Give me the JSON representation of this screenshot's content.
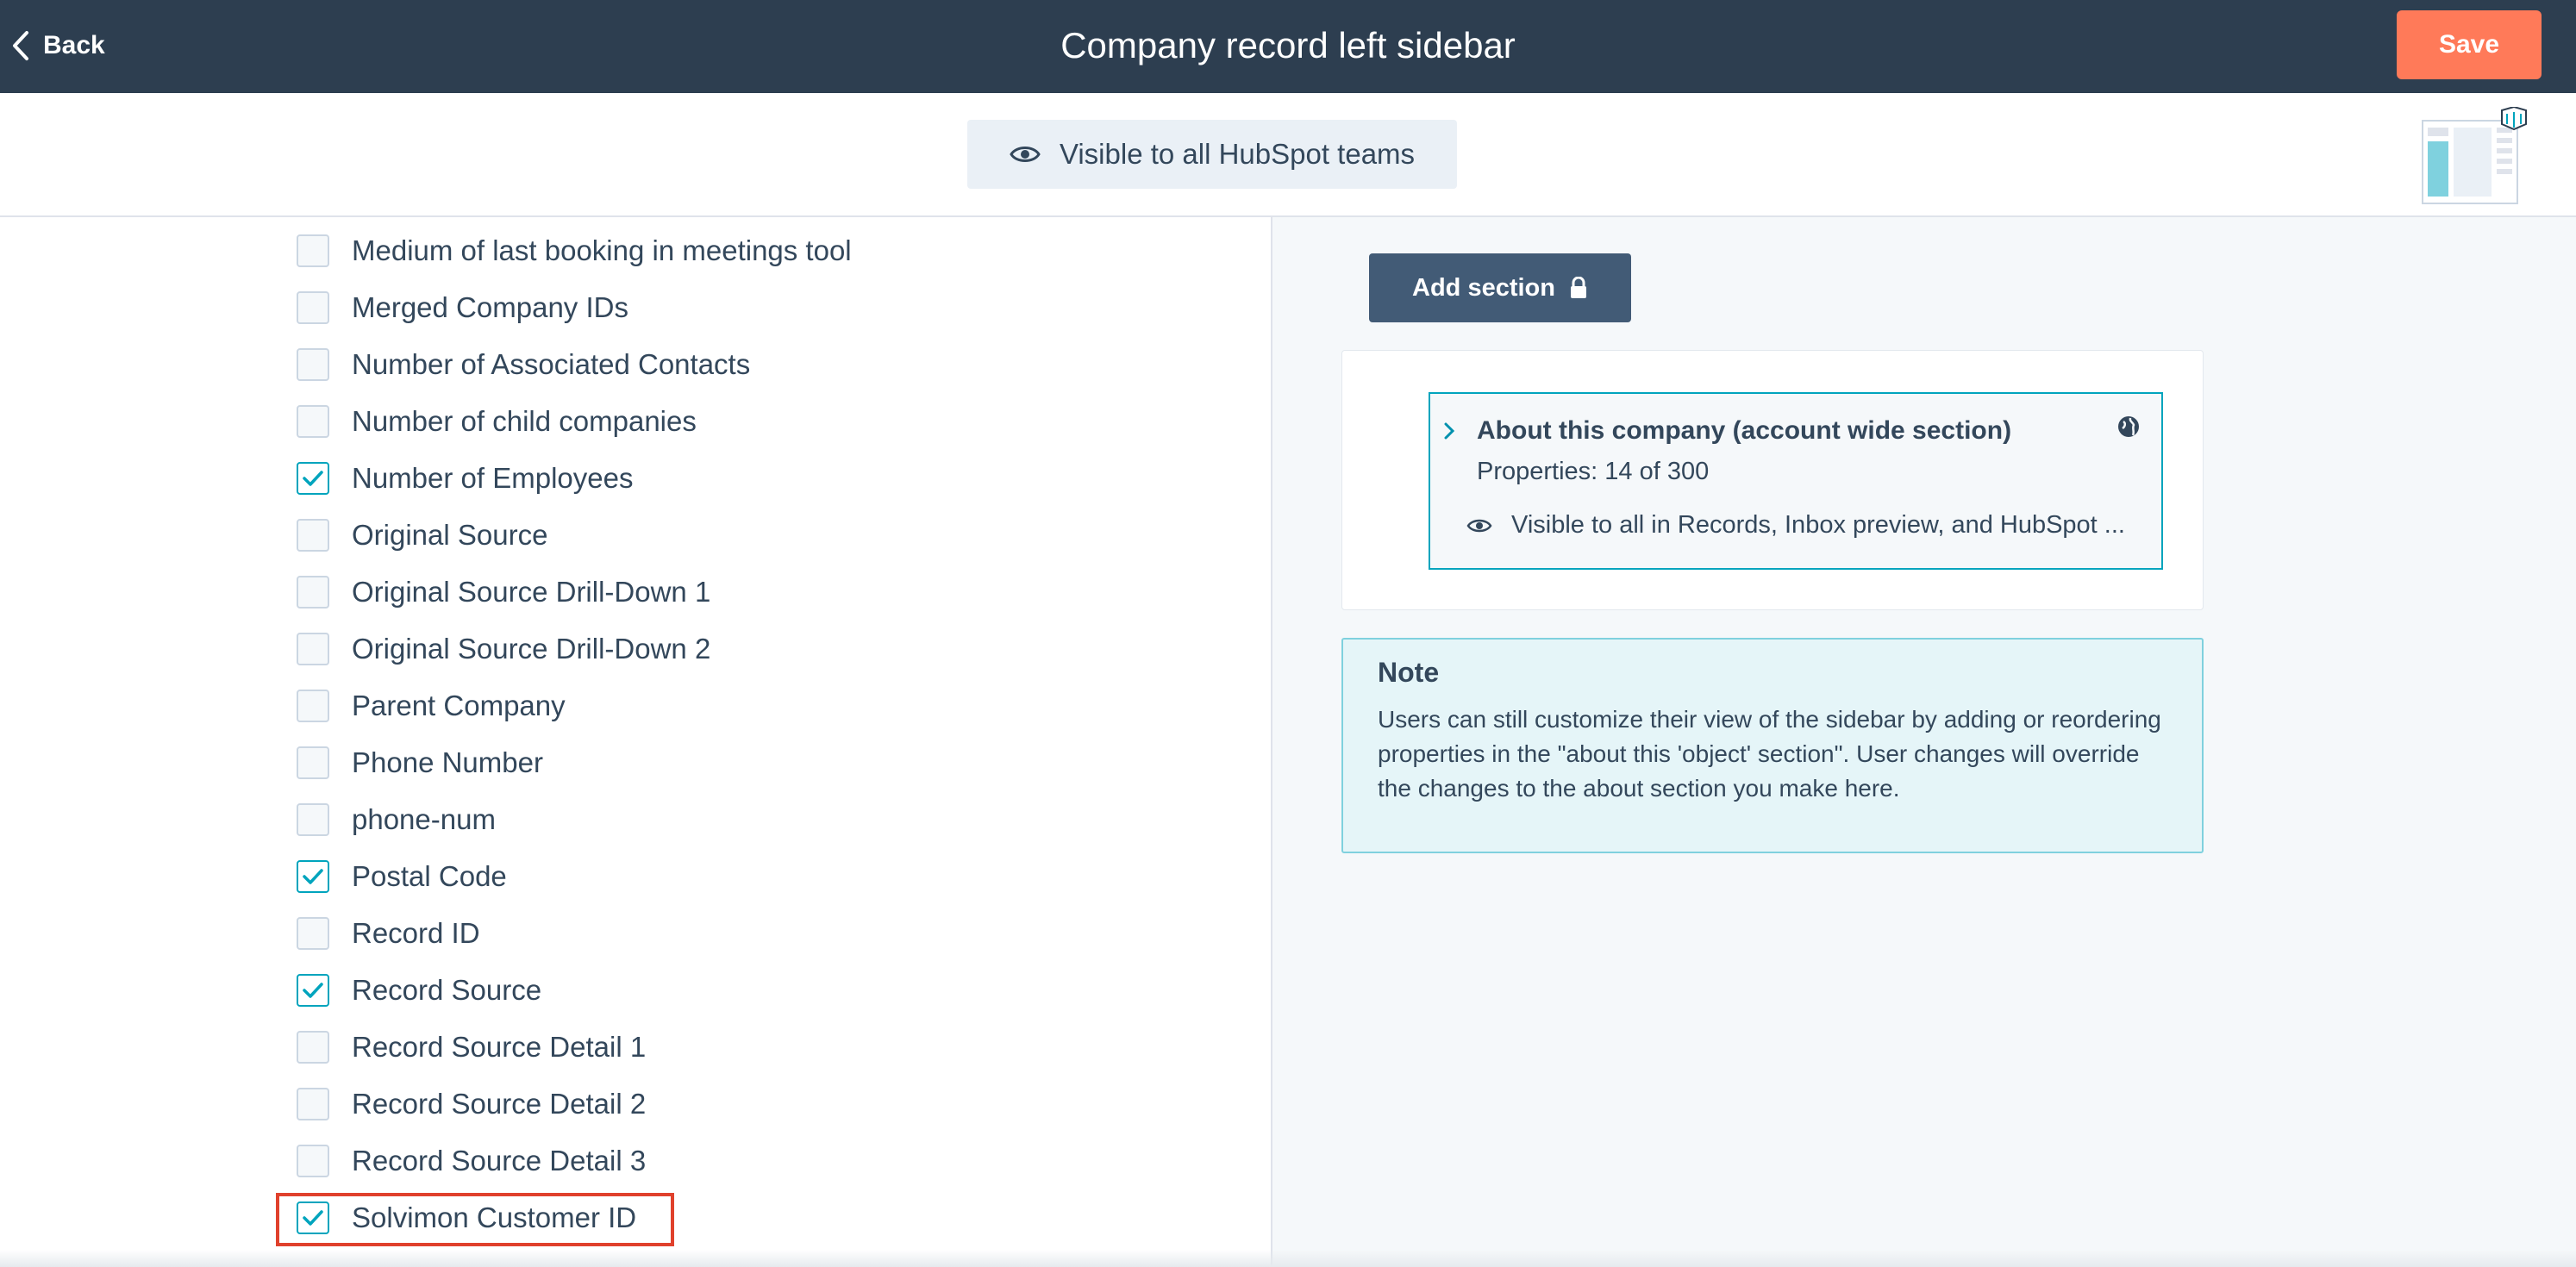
{
  "header": {
    "back_label": "Back",
    "title": "Company record left sidebar",
    "save_label": "Save"
  },
  "subheader": {
    "visibility_label": "Visible to all HubSpot teams"
  },
  "properties": [
    {
      "label": "Medium of last booking in meetings tool",
      "checked": false
    },
    {
      "label": "Merged Company IDs",
      "checked": false
    },
    {
      "label": "Number of Associated Contacts",
      "checked": false
    },
    {
      "label": "Number of child companies",
      "checked": false
    },
    {
      "label": "Number of Employees",
      "checked": true
    },
    {
      "label": "Original Source",
      "checked": false
    },
    {
      "label": "Original Source Drill-Down 1",
      "checked": false
    },
    {
      "label": "Original Source Drill-Down 2",
      "checked": false
    },
    {
      "label": "Parent Company",
      "checked": false
    },
    {
      "label": "Phone Number",
      "checked": false
    },
    {
      "label": "phone-num",
      "checked": false
    },
    {
      "label": "Postal Code",
      "checked": true
    },
    {
      "label": "Record ID",
      "checked": false
    },
    {
      "label": "Record Source",
      "checked": true
    },
    {
      "label": "Record Source Detail 1",
      "checked": false
    },
    {
      "label": "Record Source Detail 2",
      "checked": false
    },
    {
      "label": "Record Source Detail 3",
      "checked": false
    },
    {
      "label": "Solvimon Customer ID",
      "checked": true
    }
  ],
  "right_panel": {
    "add_section_label": "Add section",
    "section": {
      "title": "About this company (account wide section)",
      "properties_count": "Properties: 14 of 300",
      "visibility": "Visible to all in Records, Inbox preview, and HubSpot ..."
    },
    "note": {
      "title": "Note",
      "body": "Users can still customize their view of the sidebar by adding or reordering properties in the \"about this 'object' section\". User changes will override the changes to the about section you make here."
    }
  },
  "colors": {
    "header_bg": "#2d3e50",
    "save": "#ff7a59",
    "check": "#00a4bd",
    "highlight": "#e0412c"
  }
}
